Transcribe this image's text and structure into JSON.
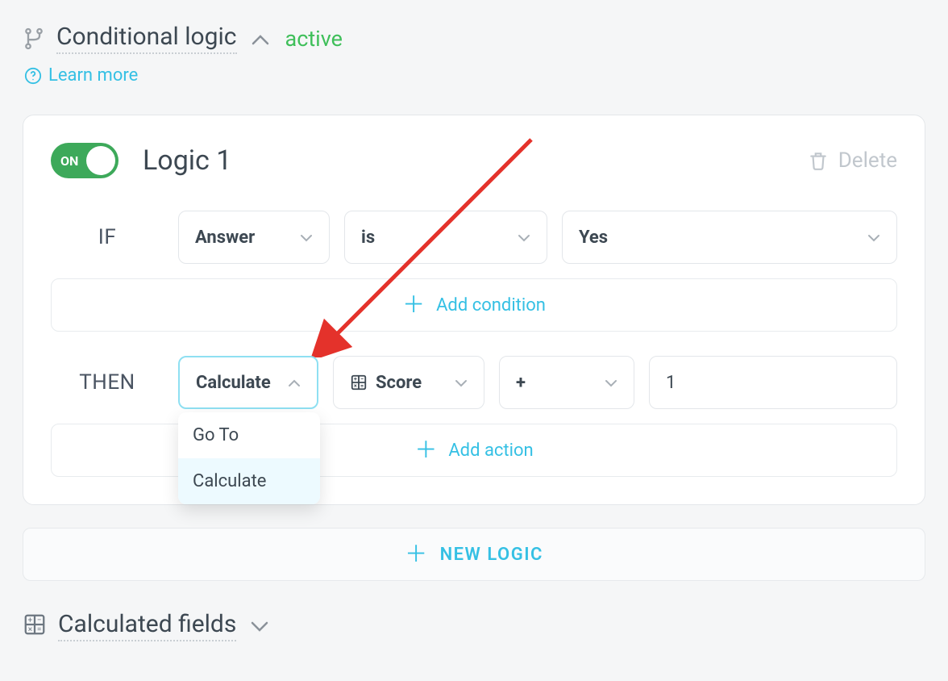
{
  "header": {
    "title": "Conditional logic",
    "status": "active",
    "learn_more": "Learn more"
  },
  "logic": {
    "toggle_label": "ON",
    "name": "Logic 1",
    "delete_label": "Delete",
    "if_label": "IF",
    "if_field": "Answer",
    "if_operator": "is",
    "if_value": "Yes",
    "add_condition": "Add condition",
    "then_label": "THEN",
    "then_action": "Calculate",
    "then_target": "Score",
    "then_operator": "+",
    "then_value": "1",
    "add_action": "Add action",
    "dropdown": {
      "opt1": "Go To",
      "opt2": "Calculate"
    }
  },
  "new_logic_label": "NEW LOGIC",
  "footer": {
    "title": "Calculated fields"
  }
}
